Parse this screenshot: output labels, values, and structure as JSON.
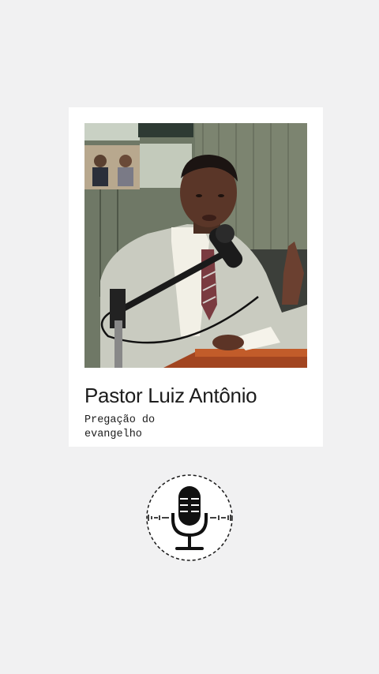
{
  "post": {
    "title": "Pastor Luiz Antônio",
    "subtitle": "Pregação do\n evangelho"
  },
  "photo": {
    "description_icon": "preacher-at-pulpit-photo"
  },
  "audio": {
    "icon": "microphone-icon"
  },
  "colors": {
    "background": "#f1f1f2",
    "card": "#ffffff",
    "text": "#1d1d1d"
  }
}
